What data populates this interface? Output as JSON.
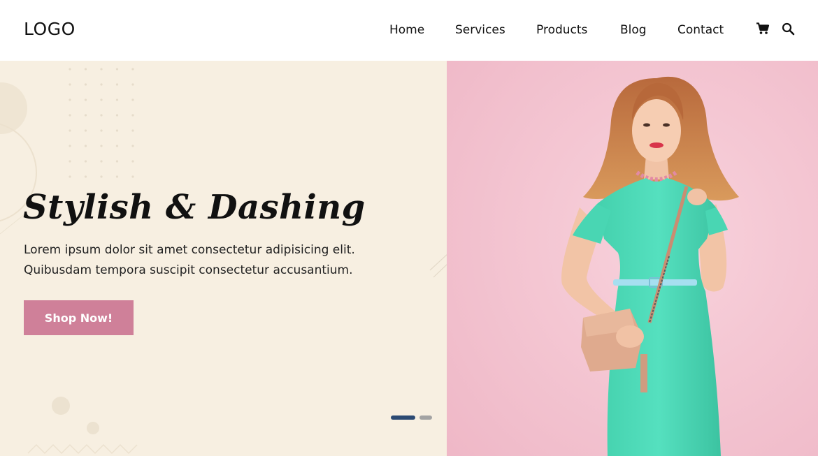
{
  "header": {
    "logo": "LOGO",
    "nav": [
      "Home",
      "Services",
      "Products",
      "Blog",
      "Contact"
    ],
    "icons": {
      "cart": "cart-icon",
      "search": "search-icon"
    }
  },
  "hero": {
    "title": "Stylish & Dashing",
    "description_line1": "Lorem ipsum dolor sit amet consectetur adipisicing elit.",
    "description_line2": "Quibusdam tempora suscipit consectetur accusantium.",
    "cta": "Shop Now!",
    "slider": {
      "active_index": 0,
      "count": 2
    }
  },
  "colors": {
    "hero_left_bg": "#f7efe1",
    "hero_right_bg": "#f3c6d2",
    "cta_bg": "#cf8099",
    "dot_active": "#2c4a73",
    "dot_inactive": "#a3a3a3",
    "dress": "#4fdcba"
  }
}
